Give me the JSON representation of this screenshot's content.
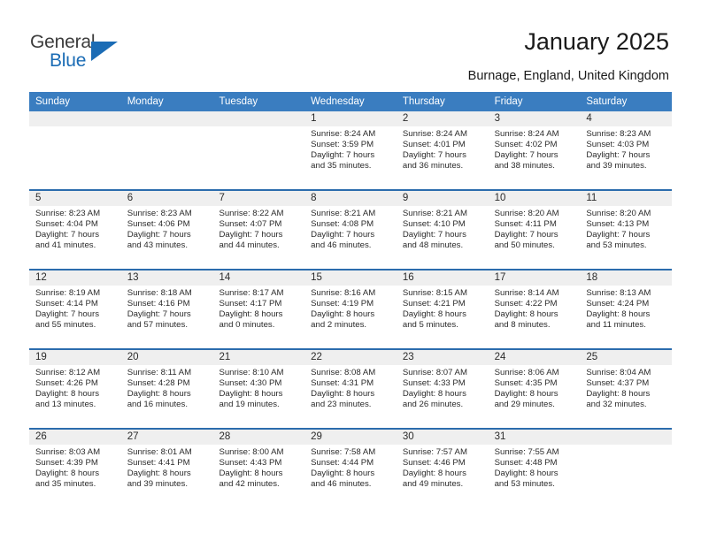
{
  "brand": {
    "name_part1": "General",
    "name_part2": "Blue",
    "accent_color": "#1b6cb5"
  },
  "header": {
    "title": "January 2025",
    "location": "Burnage, England, United Kingdom"
  },
  "calendar": {
    "header_bg": "#3a7dc0",
    "row_divider_color": "#2b6cad",
    "numrow_bg": "#efefef",
    "weekdays": [
      "Sunday",
      "Monday",
      "Tuesday",
      "Wednesday",
      "Thursday",
      "Friday",
      "Saturday"
    ],
    "weeks": [
      [
        {
          "day": "",
          "lines": []
        },
        {
          "day": "",
          "lines": []
        },
        {
          "day": "",
          "lines": []
        },
        {
          "day": "1",
          "lines": [
            "Sunrise: 8:24 AM",
            "Sunset: 3:59 PM",
            "Daylight: 7 hours",
            "and 35 minutes."
          ]
        },
        {
          "day": "2",
          "lines": [
            "Sunrise: 8:24 AM",
            "Sunset: 4:01 PM",
            "Daylight: 7 hours",
            "and 36 minutes."
          ]
        },
        {
          "day": "3",
          "lines": [
            "Sunrise: 8:24 AM",
            "Sunset: 4:02 PM",
            "Daylight: 7 hours",
            "and 38 minutes."
          ]
        },
        {
          "day": "4",
          "lines": [
            "Sunrise: 8:23 AM",
            "Sunset: 4:03 PM",
            "Daylight: 7 hours",
            "and 39 minutes."
          ]
        }
      ],
      [
        {
          "day": "5",
          "lines": [
            "Sunrise: 8:23 AM",
            "Sunset: 4:04 PM",
            "Daylight: 7 hours",
            "and 41 minutes."
          ]
        },
        {
          "day": "6",
          "lines": [
            "Sunrise: 8:23 AM",
            "Sunset: 4:06 PM",
            "Daylight: 7 hours",
            "and 43 minutes."
          ]
        },
        {
          "day": "7",
          "lines": [
            "Sunrise: 8:22 AM",
            "Sunset: 4:07 PM",
            "Daylight: 7 hours",
            "and 44 minutes."
          ]
        },
        {
          "day": "8",
          "lines": [
            "Sunrise: 8:21 AM",
            "Sunset: 4:08 PM",
            "Daylight: 7 hours",
            "and 46 minutes."
          ]
        },
        {
          "day": "9",
          "lines": [
            "Sunrise: 8:21 AM",
            "Sunset: 4:10 PM",
            "Daylight: 7 hours",
            "and 48 minutes."
          ]
        },
        {
          "day": "10",
          "lines": [
            "Sunrise: 8:20 AM",
            "Sunset: 4:11 PM",
            "Daylight: 7 hours",
            "and 50 minutes."
          ]
        },
        {
          "day": "11",
          "lines": [
            "Sunrise: 8:20 AM",
            "Sunset: 4:13 PM",
            "Daylight: 7 hours",
            "and 53 minutes."
          ]
        }
      ],
      [
        {
          "day": "12",
          "lines": [
            "Sunrise: 8:19 AM",
            "Sunset: 4:14 PM",
            "Daylight: 7 hours",
            "and 55 minutes."
          ]
        },
        {
          "day": "13",
          "lines": [
            "Sunrise: 8:18 AM",
            "Sunset: 4:16 PM",
            "Daylight: 7 hours",
            "and 57 minutes."
          ]
        },
        {
          "day": "14",
          "lines": [
            "Sunrise: 8:17 AM",
            "Sunset: 4:17 PM",
            "Daylight: 8 hours",
            "and 0 minutes."
          ]
        },
        {
          "day": "15",
          "lines": [
            "Sunrise: 8:16 AM",
            "Sunset: 4:19 PM",
            "Daylight: 8 hours",
            "and 2 minutes."
          ]
        },
        {
          "day": "16",
          "lines": [
            "Sunrise: 8:15 AM",
            "Sunset: 4:21 PM",
            "Daylight: 8 hours",
            "and 5 minutes."
          ]
        },
        {
          "day": "17",
          "lines": [
            "Sunrise: 8:14 AM",
            "Sunset: 4:22 PM",
            "Daylight: 8 hours",
            "and 8 minutes."
          ]
        },
        {
          "day": "18",
          "lines": [
            "Sunrise: 8:13 AM",
            "Sunset: 4:24 PM",
            "Daylight: 8 hours",
            "and 11 minutes."
          ]
        }
      ],
      [
        {
          "day": "19",
          "lines": [
            "Sunrise: 8:12 AM",
            "Sunset: 4:26 PM",
            "Daylight: 8 hours",
            "and 13 minutes."
          ]
        },
        {
          "day": "20",
          "lines": [
            "Sunrise: 8:11 AM",
            "Sunset: 4:28 PM",
            "Daylight: 8 hours",
            "and 16 minutes."
          ]
        },
        {
          "day": "21",
          "lines": [
            "Sunrise: 8:10 AM",
            "Sunset: 4:30 PM",
            "Daylight: 8 hours",
            "and 19 minutes."
          ]
        },
        {
          "day": "22",
          "lines": [
            "Sunrise: 8:08 AM",
            "Sunset: 4:31 PM",
            "Daylight: 8 hours",
            "and 23 minutes."
          ]
        },
        {
          "day": "23",
          "lines": [
            "Sunrise: 8:07 AM",
            "Sunset: 4:33 PM",
            "Daylight: 8 hours",
            "and 26 minutes."
          ]
        },
        {
          "day": "24",
          "lines": [
            "Sunrise: 8:06 AM",
            "Sunset: 4:35 PM",
            "Daylight: 8 hours",
            "and 29 minutes."
          ]
        },
        {
          "day": "25",
          "lines": [
            "Sunrise: 8:04 AM",
            "Sunset: 4:37 PM",
            "Daylight: 8 hours",
            "and 32 minutes."
          ]
        }
      ],
      [
        {
          "day": "26",
          "lines": [
            "Sunrise: 8:03 AM",
            "Sunset: 4:39 PM",
            "Daylight: 8 hours",
            "and 35 minutes."
          ]
        },
        {
          "day": "27",
          "lines": [
            "Sunrise: 8:01 AM",
            "Sunset: 4:41 PM",
            "Daylight: 8 hours",
            "and 39 minutes."
          ]
        },
        {
          "day": "28",
          "lines": [
            "Sunrise: 8:00 AM",
            "Sunset: 4:43 PM",
            "Daylight: 8 hours",
            "and 42 minutes."
          ]
        },
        {
          "day": "29",
          "lines": [
            "Sunrise: 7:58 AM",
            "Sunset: 4:44 PM",
            "Daylight: 8 hours",
            "and 46 minutes."
          ]
        },
        {
          "day": "30",
          "lines": [
            "Sunrise: 7:57 AM",
            "Sunset: 4:46 PM",
            "Daylight: 8 hours",
            "and 49 minutes."
          ]
        },
        {
          "day": "31",
          "lines": [
            "Sunrise: 7:55 AM",
            "Sunset: 4:48 PM",
            "Daylight: 8 hours",
            "and 53 minutes."
          ]
        },
        {
          "day": "",
          "lines": []
        }
      ]
    ]
  }
}
